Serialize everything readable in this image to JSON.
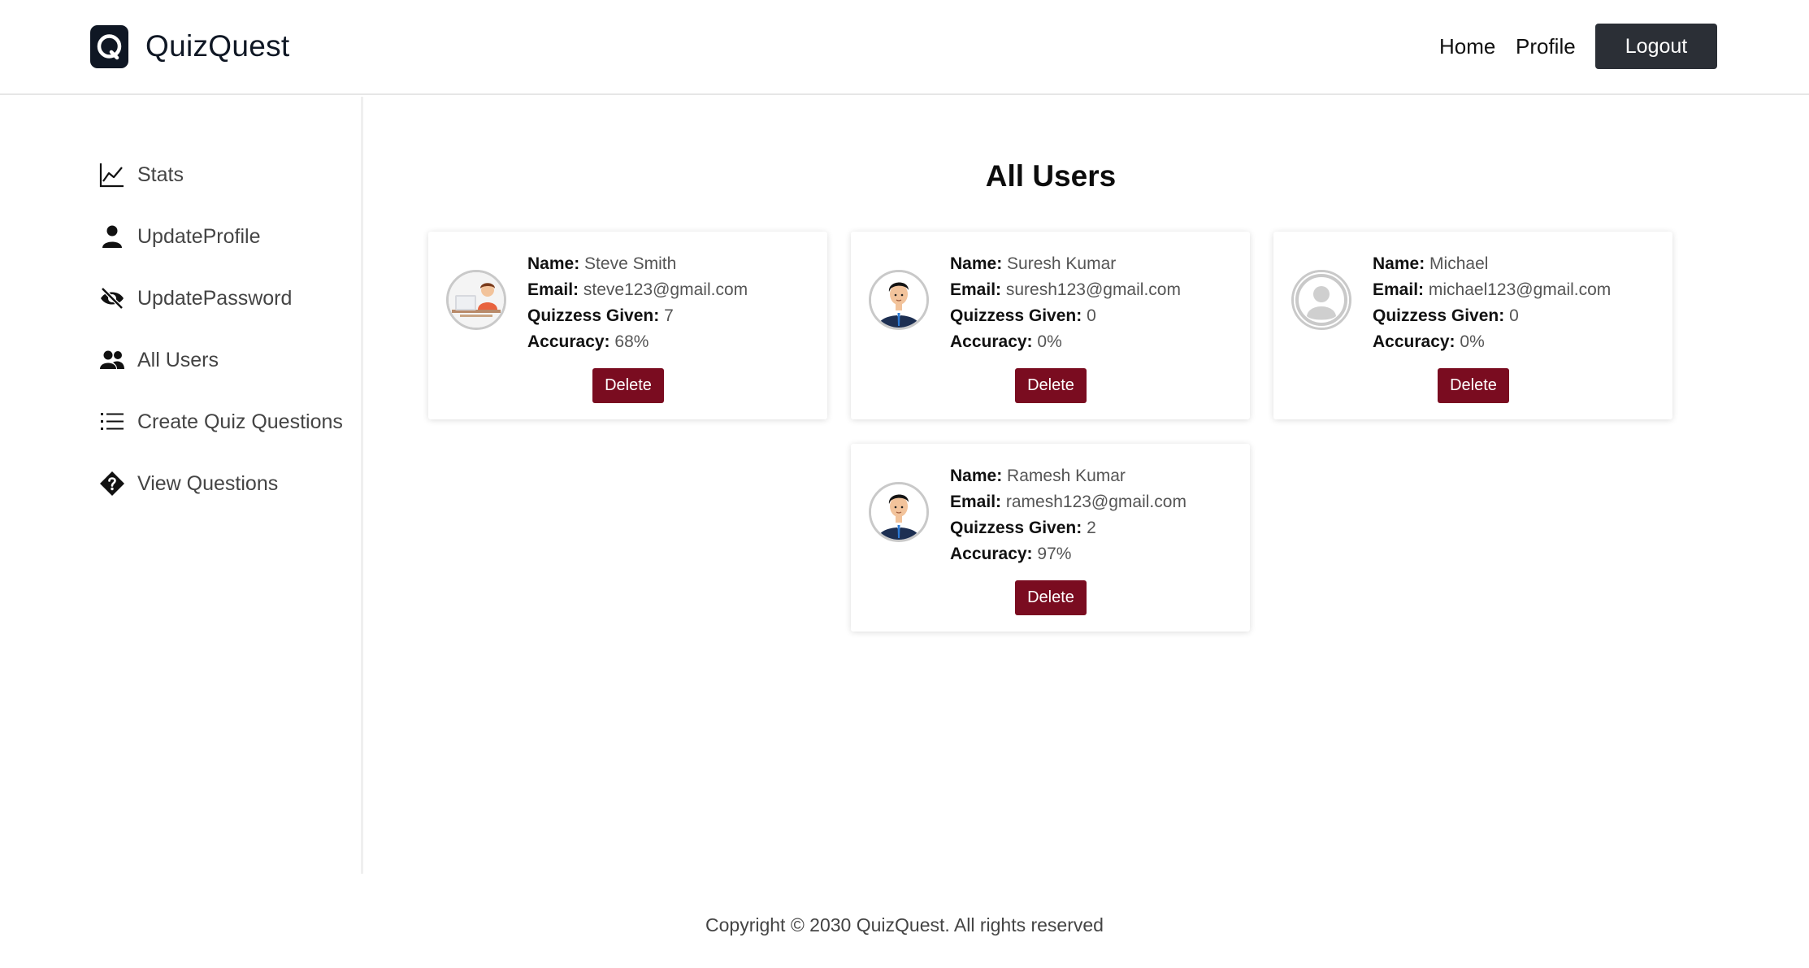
{
  "header": {
    "brand": "QuizQuest",
    "nav": {
      "home": "Home",
      "profile": "Profile",
      "logout": "Logout"
    }
  },
  "sidebar": {
    "items": [
      {
        "label": "Stats",
        "icon": "chart-line-icon"
      },
      {
        "label": "UpdateProfile",
        "icon": "user-icon"
      },
      {
        "label": "UpdatePassword",
        "icon": "eye-slash-icon"
      },
      {
        "label": "All Users",
        "icon": "users-icon"
      },
      {
        "label": "Create Quiz Questions",
        "icon": "list-icon"
      },
      {
        "label": "View Questions",
        "icon": "question-diamond-icon"
      }
    ]
  },
  "main": {
    "title": "All Users",
    "field_labels": {
      "name": "Name:",
      "email": "Email:",
      "quizzes": "Quizzess Given:",
      "accuracy": "Accuracy:"
    },
    "delete_label": "Delete",
    "users": [
      {
        "name": "Steve Smith",
        "email": "steve123@gmail.com",
        "quizzes": "7",
        "accuracy": "68%",
        "avatar": "person-at-desk-avatar"
      },
      {
        "name": "Suresh Kumar",
        "email": "suresh123@gmail.com",
        "quizzes": "0",
        "accuracy": "0%",
        "avatar": "man-avatar"
      },
      {
        "name": "Michael",
        "email": "michael123@gmail.com",
        "quizzes": "0",
        "accuracy": "0%",
        "avatar": "default-user-avatar"
      },
      {
        "name": "Ramesh Kumar",
        "email": "ramesh123@gmail.com",
        "quizzes": "2",
        "accuracy": "97%",
        "avatar": "man-avatar"
      }
    ]
  },
  "footer": {
    "copyright": "Copyright © 2030 QuizQuest. All rights reserved"
  },
  "colors": {
    "header_dark": "#2b2f36",
    "delete": "#7a0c20",
    "logo_bg": "#0f1724"
  }
}
